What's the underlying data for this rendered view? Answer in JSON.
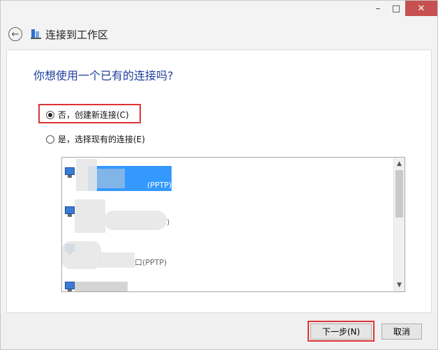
{
  "window": {
    "controls": {
      "minimize": "–",
      "maximize": "□",
      "close": "✕"
    }
  },
  "header": {
    "back_icon": "←",
    "title": "连接到工作区"
  },
  "content": {
    "question": "你想使用一个已有的连接吗?",
    "options": [
      {
        "label": "否，创建新连接(C)",
        "checked": true
      },
      {
        "label": "是，选择现有的连接(E)",
        "checked": false
      }
    ],
    "connections": [
      {
        "suffix": "(PPTP)",
        "selected": true
      },
      {
        "suffix": ")",
        "selected": false
      },
      {
        "suffix": "口(PPTP)",
        "selected": false
      },
      {
        "suffix": "",
        "selected": false
      }
    ],
    "scroll": {
      "up": "▲",
      "down": "▼"
    }
  },
  "footer": {
    "next_label": "下一步(N)",
    "cancel_label": "取消"
  },
  "colors": {
    "accent": "#1e3f9c",
    "selection": "#3399ff",
    "highlight_box": "#dd3333",
    "close_button": "#c75050"
  }
}
